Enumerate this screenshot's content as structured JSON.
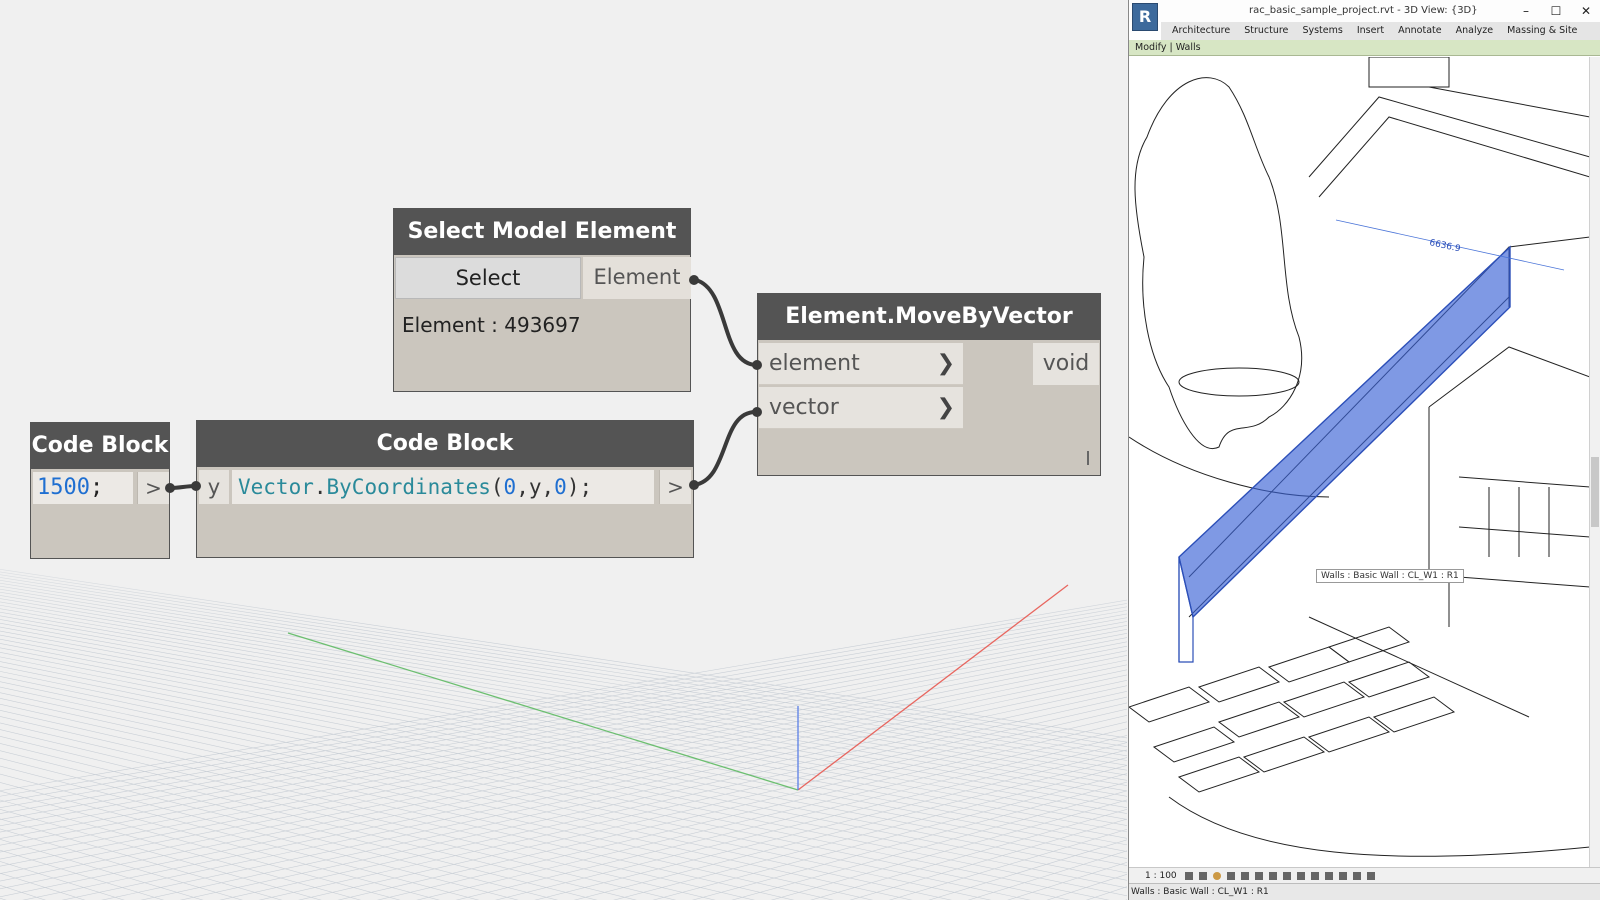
{
  "dynamo": {
    "nodes": {
      "select_model_element": {
        "title": "Select Model Element",
        "select_button": "Select",
        "output_port": "Element",
        "value": "Element : 493697"
      },
      "move_by_vector": {
        "title": "Element.MoveByVector",
        "input_element": "element",
        "input_vector": "vector",
        "output_port": "void"
      },
      "code_block_1": {
        "title": "Code Block",
        "code_number": "1500",
        "code_end": ";",
        "output_port": ">"
      },
      "code_block_2": {
        "title": "Code Block",
        "input_port": "y",
        "output_port": ">",
        "code": {
          "fn": "Vector",
          "dot": ".",
          "method": "ByCoordinates",
          "open": "(",
          "a": "0",
          "c1": ",",
          "b": "y",
          "c2": ",",
          "c": "0",
          "close": ");"
        }
      }
    },
    "colors": {
      "node_header": "#545454",
      "node_body": "#cbc6be",
      "number_literal": "#1f6fd1",
      "code_identifier": "#2a8a9a",
      "wire": "#3a3a3a",
      "axis_x": "#e0413b",
      "axis_y": "#4caf50",
      "axis_z": "#3b6ce0"
    }
  },
  "revit": {
    "logo": "R",
    "title": "rac_basic_sample_project.rvt - 3D View: {3D}",
    "window_controls": [
      "–",
      "☐",
      "✕"
    ],
    "ribbon_tabs": [
      "Architecture",
      "Structure",
      "Systems",
      "Insert",
      "Annotate",
      "Analyze",
      "Massing & Site"
    ],
    "context_tab": "Modify | Walls",
    "dimension": "6636.9",
    "tooltip": "Walls : Basic Wall : CL_W1 : R1",
    "scale": "1 : 100",
    "status": "Walls : Basic Wall : CL_W1 : R1",
    "selection_color": "#3a62d6"
  }
}
